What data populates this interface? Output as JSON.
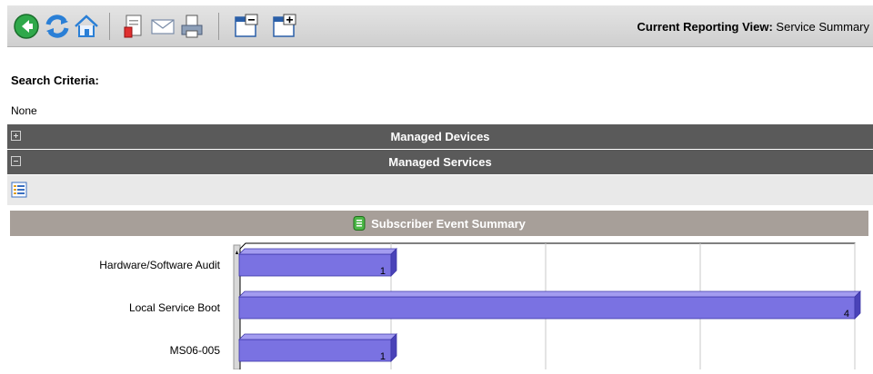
{
  "toolbar": {
    "icons": [
      "back-icon",
      "refresh-icon",
      "home-icon",
      "export-pdf-icon",
      "email-icon",
      "print-icon",
      "collapse-panel-icon",
      "expand-panel-icon"
    ],
    "view_label_prefix": "Current Reporting View:",
    "view_label_value": "Service Summary"
  },
  "search_criteria": {
    "title": "Search Criteria:",
    "value": "None"
  },
  "sections": {
    "managed_devices": "Managed Devices",
    "managed_services": "Managed Services"
  },
  "summary": {
    "title": "Subscriber Event Summary"
  },
  "colors": {
    "section_bar": "#5a5a5a",
    "summary_bar": "#a79f99",
    "bar_fill": "#7a72e2"
  },
  "chart_data": {
    "type": "bar",
    "orientation": "horizontal",
    "categories": [
      "Hardware/Software Audit",
      "Local Service Boot",
      "MS06-005"
    ],
    "values": [
      1,
      4,
      1
    ],
    "xlim": [
      0,
      4
    ],
    "grid": true
  }
}
